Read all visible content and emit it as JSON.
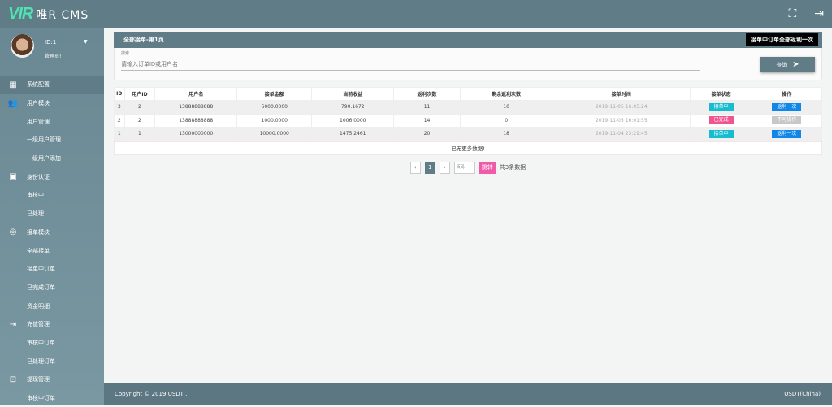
{
  "app": {
    "logo_mark": "VIR",
    "title": "唯R CMS"
  },
  "user": {
    "id": "ID:1",
    "role": "管理员!"
  },
  "sidebar": [
    {
      "label": "系统配置",
      "type": "group",
      "icon": "dashboard-icon",
      "glyph": "▦"
    },
    {
      "label": "用户模块",
      "type": "group",
      "icon": "users-icon",
      "glyph": "👥"
    },
    {
      "label": "用户管理",
      "type": "sub"
    },
    {
      "label": "一级用户管理",
      "type": "sub"
    },
    {
      "label": "一级用户添加",
      "type": "sub"
    },
    {
      "label": "身份认证",
      "type": "group",
      "icon": "id-card-icon",
      "glyph": "▣"
    },
    {
      "label": "审核中",
      "type": "sub"
    },
    {
      "label": "已处理",
      "type": "sub"
    },
    {
      "label": "接单模块",
      "type": "group",
      "icon": "fingerprint-icon",
      "glyph": "◎"
    },
    {
      "label": "全部接单",
      "type": "sub"
    },
    {
      "label": "接单中订单",
      "type": "sub"
    },
    {
      "label": "已完成订单",
      "type": "sub"
    },
    {
      "label": "资金明细",
      "type": "sub"
    },
    {
      "label": "充值管理",
      "type": "group",
      "icon": "login-icon",
      "glyph": "⇥"
    },
    {
      "label": "审核中订单",
      "type": "sub"
    },
    {
      "label": "已处理订单",
      "type": "sub"
    },
    {
      "label": "提现管理",
      "type": "group",
      "icon": "withdraw-icon",
      "glyph": "⊡"
    },
    {
      "label": "审核中订单",
      "type": "sub"
    }
  ],
  "panel": {
    "title": "全部接单-第1页",
    "rebate_all": "接单中订单全部返利一次"
  },
  "search": {
    "label": "搜索",
    "placeholder": "请输入订单ID或用户名",
    "button": "查询"
  },
  "table": {
    "headers": [
      "ID",
      "用户ID",
      "用户名",
      "接单金额",
      "当前收益",
      "返利次数",
      "剩余返利次数",
      "接单时间",
      "接单状态",
      "操作"
    ],
    "rows": [
      {
        "id": "3",
        "uid": "2",
        "name": "13888888888",
        "amount": "6000.0000",
        "income": "790.1672",
        "rebates": "11",
        "remaining": "10",
        "time": "2019-11-05 16:05:24",
        "status": "接单中",
        "status_color": "#17bcd0",
        "action": "返利一次",
        "action_color": "#0f86e8"
      },
      {
        "id": "2",
        "uid": "2",
        "name": "13888888888",
        "amount": "1000.0000",
        "income": "1006.0000",
        "rebates": "14",
        "remaining": "0",
        "time": "2019-11-05 16:01:55",
        "status": "已完成",
        "status_color": "#f0558f",
        "action": "不可操作",
        "action_color": "#c8c8c8"
      },
      {
        "id": "1",
        "uid": "1",
        "name": "13000000000",
        "amount": "10000.0000",
        "income": "1475.2461",
        "rebates": "20",
        "remaining": "18",
        "time": "2019-11-04 23:29:45",
        "status": "接单中",
        "status_color": "#17bcd0",
        "action": "返利一次",
        "action_color": "#0f86e8"
      }
    ],
    "no_more": "已无更多数据!"
  },
  "pager": {
    "prev": "‹",
    "current": "1",
    "next": "›",
    "page_placeholder": "页码",
    "jump": "跳转",
    "total": "共3条数据"
  },
  "footer": {
    "copyright": "Copyright © 2019 USDT .",
    "right": "USDT(China)"
  }
}
